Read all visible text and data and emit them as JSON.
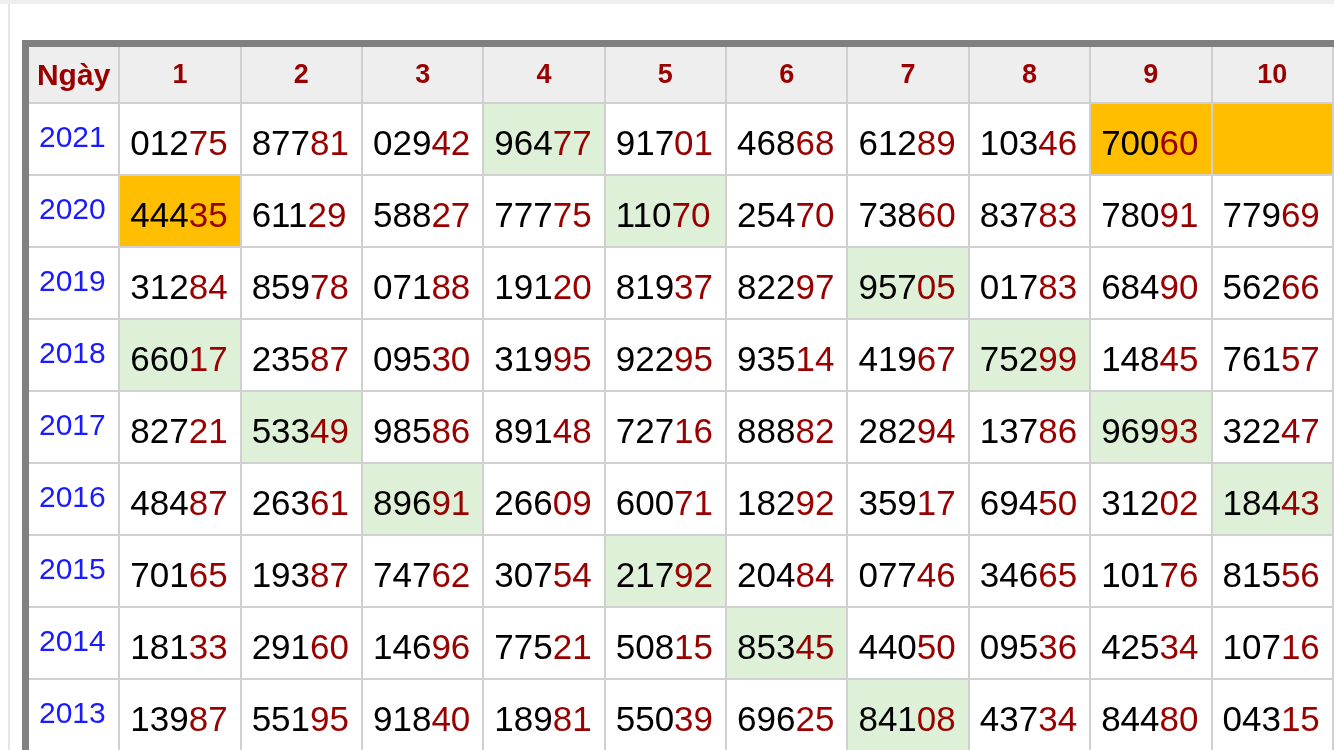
{
  "table": {
    "corner_header": "Ngày",
    "columns": [
      "1",
      "2",
      "3",
      "4",
      "5",
      "6",
      "7",
      "8",
      "9",
      "10"
    ],
    "rows": [
      {
        "year": "2021",
        "cells": [
          {
            "value": "01275"
          },
          {
            "value": "87781"
          },
          {
            "value": "02942"
          },
          {
            "value": "96477",
            "color": "#dff0d8"
          },
          {
            "value": "91701"
          },
          {
            "value": "46868"
          },
          {
            "value": "61289"
          },
          {
            "value": "10346"
          },
          {
            "value": "70060",
            "color": "#ffbf00"
          },
          {
            "color": "#ffbf00"
          }
        ]
      },
      {
        "year": "2020",
        "cells": [
          {
            "value": "44435",
            "color": "#ffbf00"
          },
          {
            "value": "61129"
          },
          {
            "value": "58827"
          },
          {
            "value": "77775"
          },
          {
            "value": "11070",
            "color": "#dff0d8"
          },
          {
            "value": "25470"
          },
          {
            "value": "73860"
          },
          {
            "value": "83783"
          },
          {
            "value": "78091"
          },
          {
            "value": "77969"
          }
        ]
      },
      {
        "year": "2019",
        "cells": [
          {
            "value": "31284"
          },
          {
            "value": "85978"
          },
          {
            "value": "07188"
          },
          {
            "value": "19120"
          },
          {
            "value": "81937"
          },
          {
            "value": "82297"
          },
          {
            "value": "95705",
            "color": "#dff0d8"
          },
          {
            "value": "01783"
          },
          {
            "value": "68490"
          },
          {
            "value": "56266"
          }
        ]
      },
      {
        "year": "2018",
        "cells": [
          {
            "value": "66017",
            "color": "#dff0d8"
          },
          {
            "value": "23587"
          },
          {
            "value": "09530"
          },
          {
            "value": "31995"
          },
          {
            "value": "92295"
          },
          {
            "value": "93514"
          },
          {
            "value": "41967"
          },
          {
            "value": "75299",
            "color": "#dff0d8"
          },
          {
            "value": "14845"
          },
          {
            "value": "76157"
          }
        ]
      },
      {
        "year": "2017",
        "cells": [
          {
            "value": "82721"
          },
          {
            "value": "53349",
            "color": "#dff0d8"
          },
          {
            "value": "98586"
          },
          {
            "value": "89148"
          },
          {
            "value": "72716"
          },
          {
            "value": "88882"
          },
          {
            "value": "28294"
          },
          {
            "value": "13786"
          },
          {
            "value": "96993",
            "color": "#dff0d8"
          },
          {
            "value": "32247"
          }
        ]
      },
      {
        "year": "2016",
        "cells": [
          {
            "value": "48487"
          },
          {
            "value": "26361"
          },
          {
            "value": "89691",
            "color": "#dff0d8"
          },
          {
            "value": "26609"
          },
          {
            "value": "60071"
          },
          {
            "value": "18292"
          },
          {
            "value": "35917"
          },
          {
            "value": "69450"
          },
          {
            "value": "31202"
          },
          {
            "value": "18443",
            "color": "#dff0d8"
          }
        ]
      },
      {
        "year": "2015",
        "cells": [
          {
            "value": "70165"
          },
          {
            "value": "19387"
          },
          {
            "value": "74762"
          },
          {
            "value": "30754"
          },
          {
            "value": "21792",
            "color": "#dff0d8"
          },
          {
            "value": "20484"
          },
          {
            "value": "07746"
          },
          {
            "value": "34665"
          },
          {
            "value": "10176"
          },
          {
            "value": "81556"
          }
        ]
      },
      {
        "year": "2014",
        "cells": [
          {
            "value": "18133"
          },
          {
            "value": "29160"
          },
          {
            "value": "14696"
          },
          {
            "value": "77521"
          },
          {
            "value": "50815"
          },
          {
            "value": "85345",
            "color": "#dff0d8"
          },
          {
            "value": "44050"
          },
          {
            "value": "09536"
          },
          {
            "value": "42534"
          },
          {
            "value": "10716"
          }
        ]
      },
      {
        "year": "2013",
        "cells": [
          {
            "value": "13987"
          },
          {
            "value": "55195"
          },
          {
            "value": "91840"
          },
          {
            "value": "18981"
          },
          {
            "value": "55039"
          },
          {
            "value": "69625"
          },
          {
            "value": "84108",
            "color": "#dff0d8"
          },
          {
            "value": "43734"
          },
          {
            "value": "84480"
          },
          {
            "value": "04315"
          }
        ]
      }
    ]
  }
}
